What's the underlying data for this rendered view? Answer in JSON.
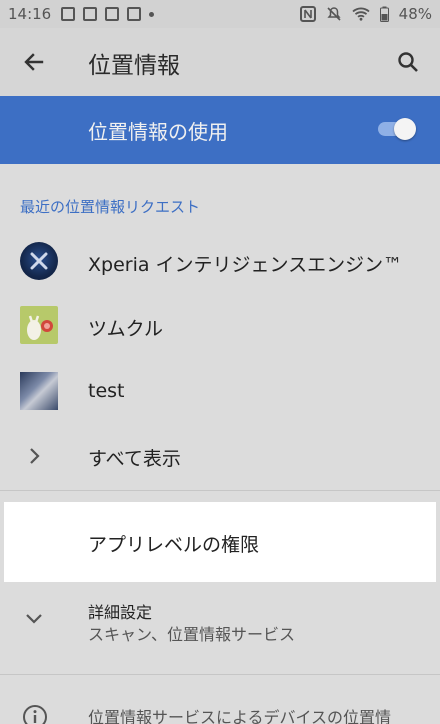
{
  "status_bar": {
    "time": "14:16",
    "battery": "48%",
    "icons": [
      "image-icon",
      "mail-icon",
      "mail-icon",
      "app-icon",
      "dot-icon",
      "nfc-icon",
      "mute-icon",
      "wifi-icon",
      "battery-icon"
    ]
  },
  "header": {
    "title": "位置情報",
    "back_icon": "arrow-left-icon",
    "search_icon": "search-icon"
  },
  "master_switch": {
    "label": "位置情報の使用",
    "enabled": true,
    "accent": "#3d6fc4"
  },
  "recent_requests": {
    "header": "最近の位置情報リクエスト",
    "apps": [
      {
        "name": "Xperia インテリジェンスエンジン™",
        "icon": "xperia-icon"
      },
      {
        "name": "ツムクル",
        "icon": "tsumukuru-icon"
      },
      {
        "name": "test",
        "icon": "test-app-icon"
      }
    ],
    "see_all": "すべて表示"
  },
  "app_level": {
    "label": "アプリレベルの権限"
  },
  "advanced": {
    "title": "詳細設定",
    "summary": "スキャン、位置情報サービス"
  },
  "footer_info": {
    "text": "位置情報サービスによるデバイスの位置情"
  }
}
